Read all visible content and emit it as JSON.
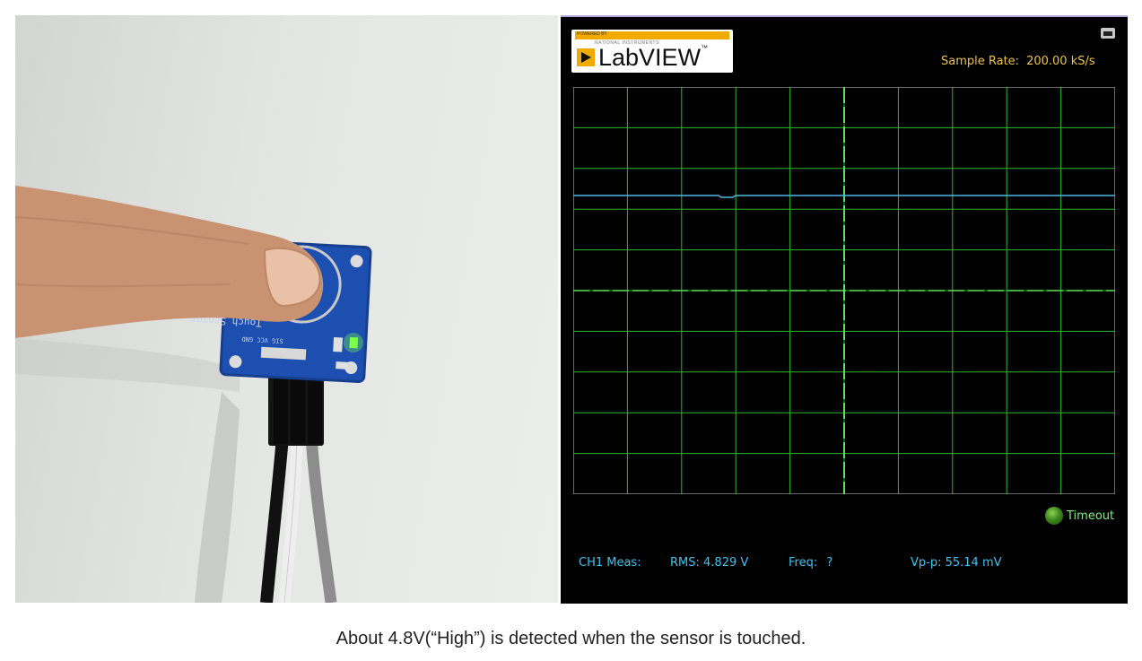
{
  "scope": {
    "logo_top": "POWERED BY",
    "logo_sub": "NATIONAL INSTRUMENTS",
    "brand": "LabVIEW",
    "sample_rate_label": "Sample Rate:",
    "sample_rate_value": "200.00 kS/s",
    "timeout_label": "Timeout",
    "meas": {
      "channel": "CH1 Meas:",
      "rms_label": "RMS:",
      "rms_value": "4.829 V",
      "freq_label": "Freq:",
      "freq_value": "?",
      "vpp_label": "Vp-p:",
      "vpp_value": "55.14 mV"
    },
    "colors": {
      "grid": "#2fb82f",
      "trace": "#4fb8e0",
      "label": "#f0c24a",
      "meas": "#3fc3f0"
    }
  },
  "photo": {
    "board_label": "Touch Sensor",
    "pins": "SIG VCC GND"
  },
  "caption": "About 4.8V(“High”) is detected when the sensor is touched."
}
